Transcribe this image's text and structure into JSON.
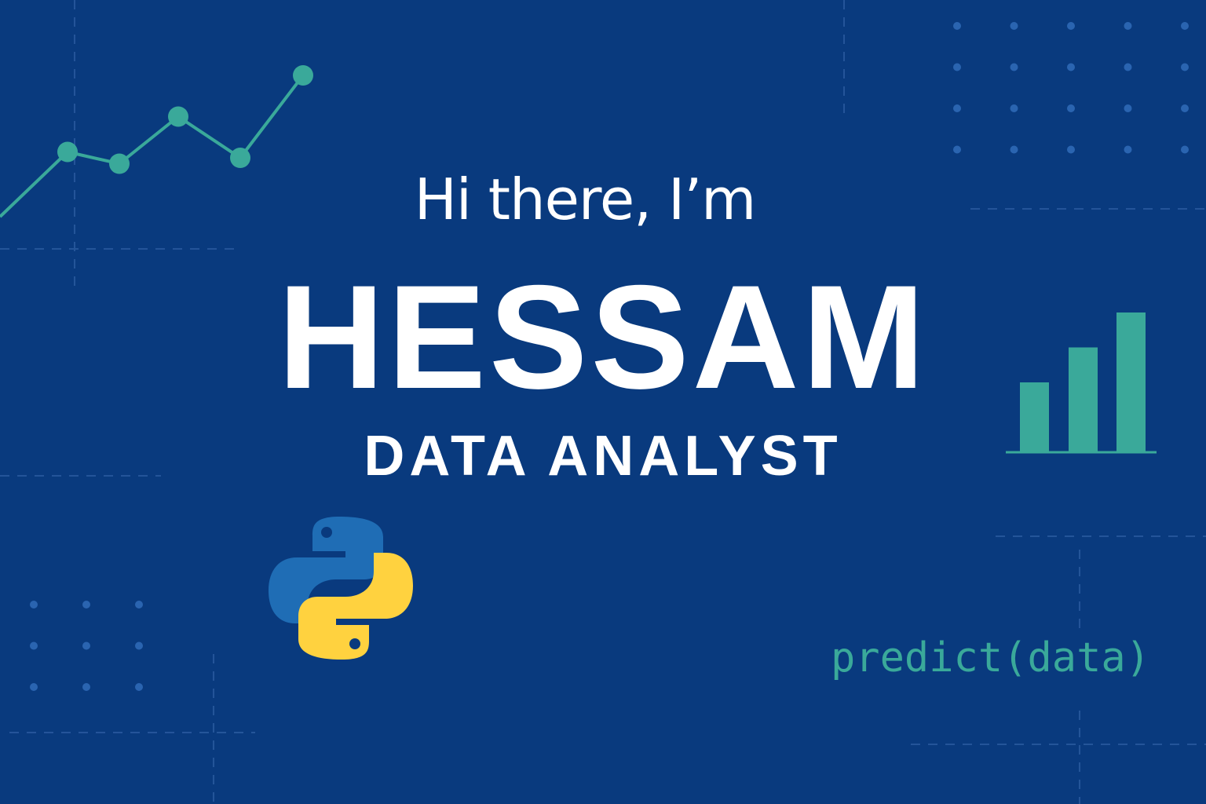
{
  "hero": {
    "greeting": "Hi there, I’m",
    "name": "HESSAM",
    "role": "DATA ANALYST"
  },
  "code_snippet": "predict(data)",
  "icons": {
    "python": "python-logo-icon",
    "line_chart": "line-chart-icon",
    "bar_chart": "bar-chart-icon"
  },
  "colors": {
    "background": "#093a7e",
    "accent_teal": "#3aa99a",
    "python_blue": "#1f6db5",
    "python_yellow": "#ffd23f",
    "text": "#ffffff"
  },
  "chart_data": [
    {
      "type": "line",
      "x": [
        1,
        2,
        3,
        4,
        5,
        6
      ],
      "values": [
        0,
        5.5,
        4.5,
        8.5,
        5,
        12
      ]
    },
    {
      "type": "bar",
      "categories": [
        "",
        "",
        ""
      ],
      "values": [
        2,
        3,
        4
      ]
    }
  ]
}
